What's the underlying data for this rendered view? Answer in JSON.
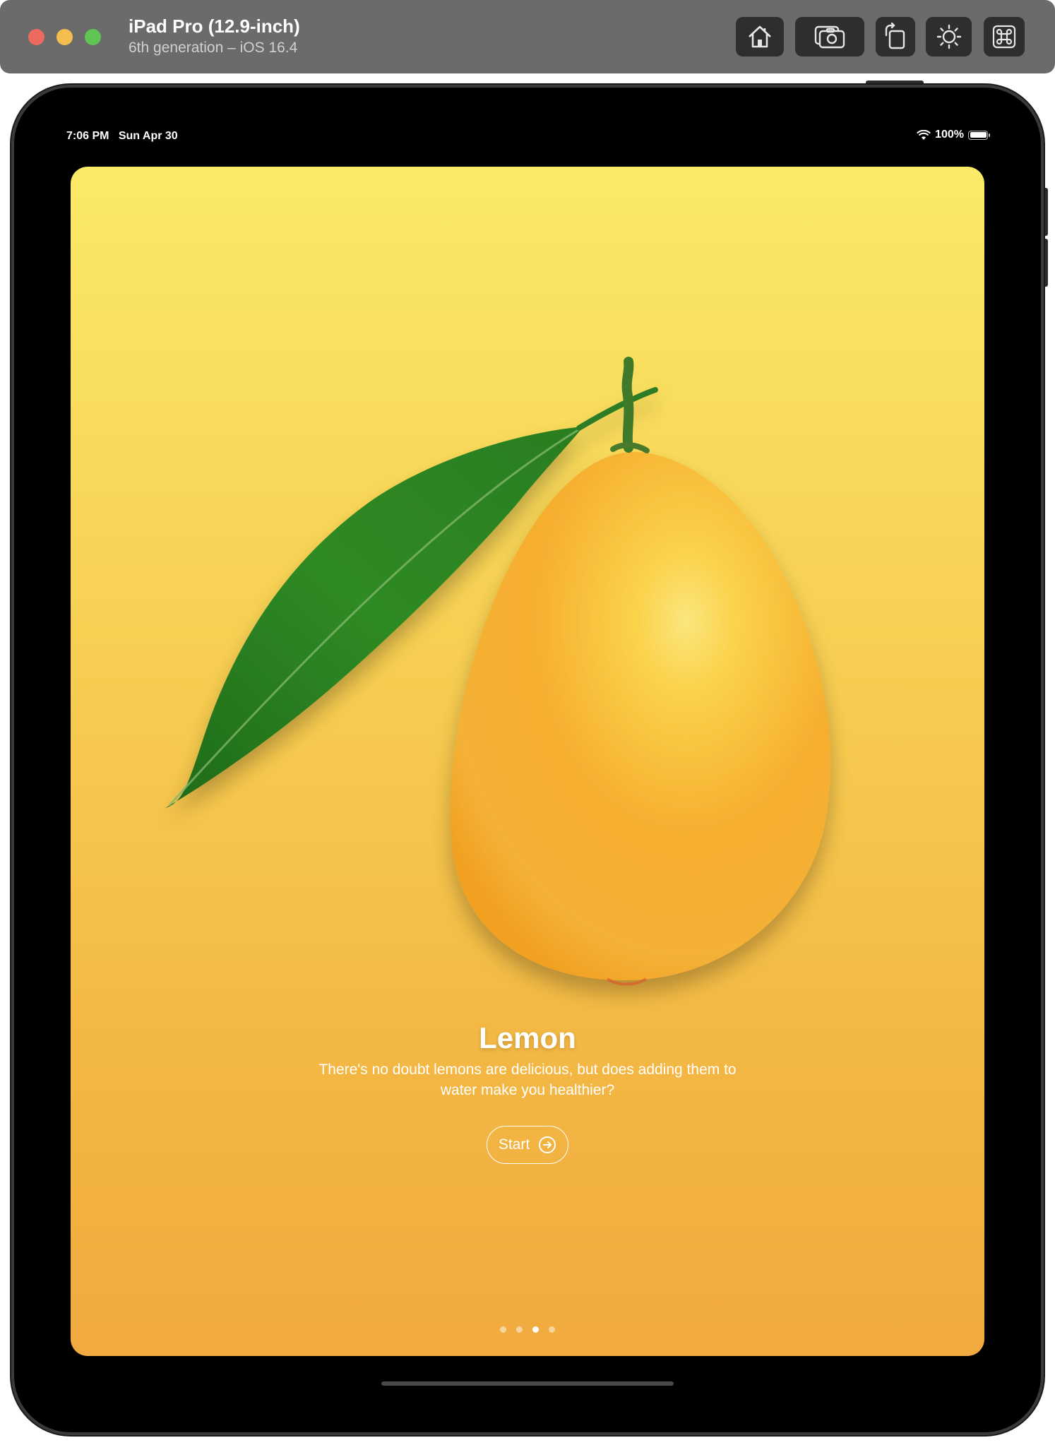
{
  "window": {
    "device_name": "iPad Pro (12.9-inch)",
    "device_subtitle": "6th generation – iOS 16.4",
    "toolbar": {
      "home": "home-icon",
      "screenshot": "camera-icon",
      "rotate": "rotate-icon",
      "appearance": "brightness-icon",
      "shortcuts": "command-icon"
    }
  },
  "status_bar": {
    "time": "7:06 PM",
    "date": "Sun Apr 30",
    "battery": "100%",
    "wifi": "wifi-icon"
  },
  "card": {
    "title": "Lemon",
    "description": "There's no doubt lemons are delicious, but does adding them to water make you healthier?",
    "start_label": "Start",
    "pager": {
      "count": 4,
      "active_index": 2
    },
    "colors": {
      "gradient_top": "#fbea67",
      "gradient_bottom": "#f1aa3f",
      "text": "#ffffff"
    }
  }
}
